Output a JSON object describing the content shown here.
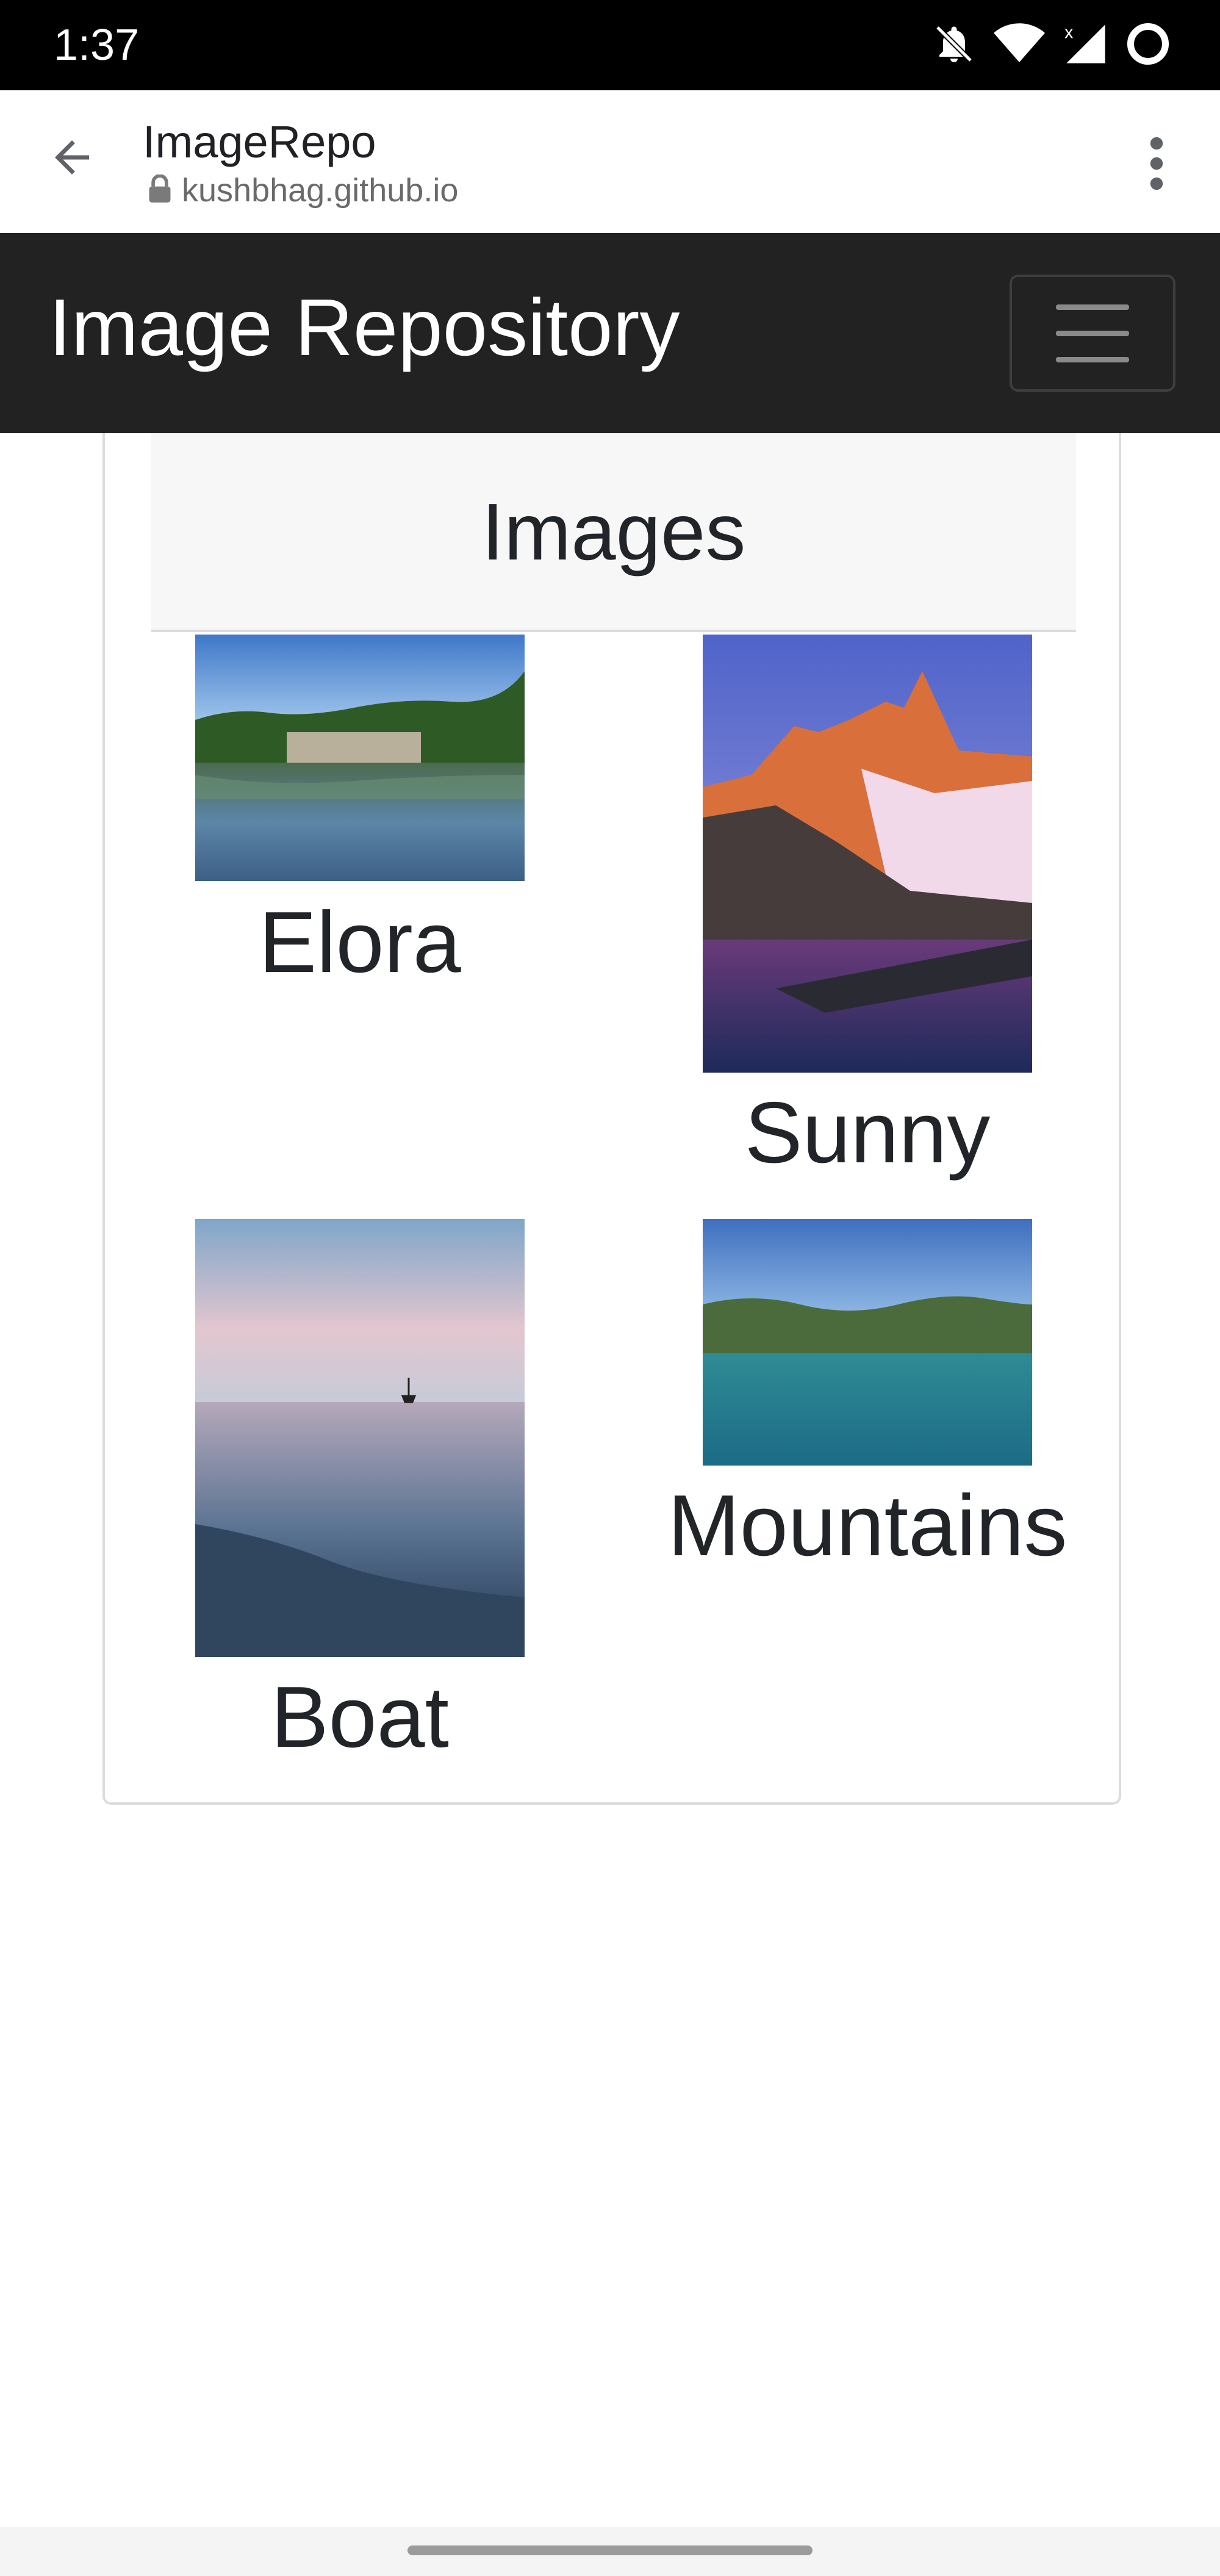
{
  "status_bar": {
    "time": "1:37",
    "icons": [
      "bell-off-icon",
      "wifi-icon",
      "cell-signal-icon",
      "battery-ring-icon"
    ]
  },
  "browser": {
    "page_name": "ImageRepo",
    "url": "kushbhag.github.io",
    "icons": [
      "back-arrow-icon",
      "lock-icon",
      "more-vert-icon"
    ]
  },
  "navbar": {
    "brand": "Image Repository",
    "toggler_icon": "hamburger-icon"
  },
  "card": {
    "title": "Images",
    "items": [
      {
        "caption": "Elora",
        "image": "lake-cliffs-forest-reflection"
      },
      {
        "caption": "Sunny",
        "image": "snowy-mountain-peaks-sunrise-lake"
      },
      {
        "caption": "Boat",
        "image": "sailboat-sea-dusk-rocks"
      },
      {
        "caption": "Mountains",
        "image": "turquoise-lake-green-hills"
      }
    ]
  },
  "colors": {
    "navbar_bg": "#222222",
    "header_bg": "#f7f7f7",
    "text": "#212529"
  }
}
